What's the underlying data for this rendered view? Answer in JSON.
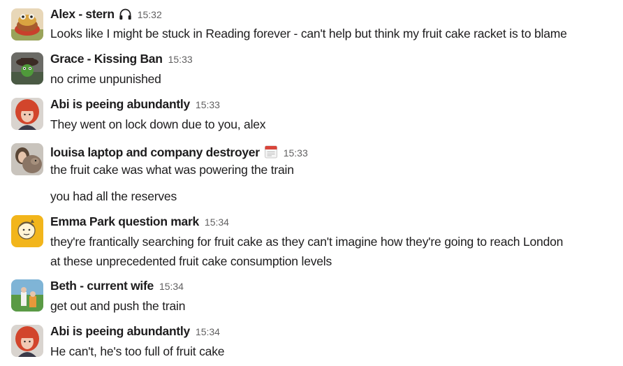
{
  "messages": [
    {
      "sender": "Alex - stern",
      "status_icon": "headphones-icon",
      "time": "15:32",
      "avatar": "avatar-alex",
      "lines": [
        "Looks like I might be stuck in Reading forever - can't help but think my fruit cake racket is to blame"
      ]
    },
    {
      "sender": "Grace - Kissing Ban",
      "time": "15:33",
      "avatar": "avatar-grace",
      "lines": [
        "no crime unpunished"
      ]
    },
    {
      "sender": "Abi is peeing abundantly",
      "time": "15:33",
      "avatar": "avatar-abi",
      "lines": [
        "They went on lock down due to you, alex"
      ]
    },
    {
      "sender": "louisa laptop and company destroyer",
      "status_icon": "calendar-icon",
      "time": "15:33",
      "avatar": "avatar-louisa",
      "lines": [
        "the fruit cake was what was powering the train",
        "you had all the reserves"
      ]
    },
    {
      "sender": "Emma Park question mark",
      "time": "15:34",
      "avatar": "avatar-emma",
      "lines": [
        "they're frantically searching for fruit cake as they can't imagine how they're going to reach London",
        "at these unprecedented fruit cake consumption levels"
      ]
    },
    {
      "sender": "Beth - current wife",
      "time": "15:34",
      "avatar": "avatar-beth",
      "lines": [
        "get out and push the train"
      ]
    },
    {
      "sender": "Abi is peeing abundantly",
      "time": "15:34",
      "avatar": "avatar-abi",
      "lines": [
        "He can't, he's too full of fruit cake"
      ]
    }
  ]
}
